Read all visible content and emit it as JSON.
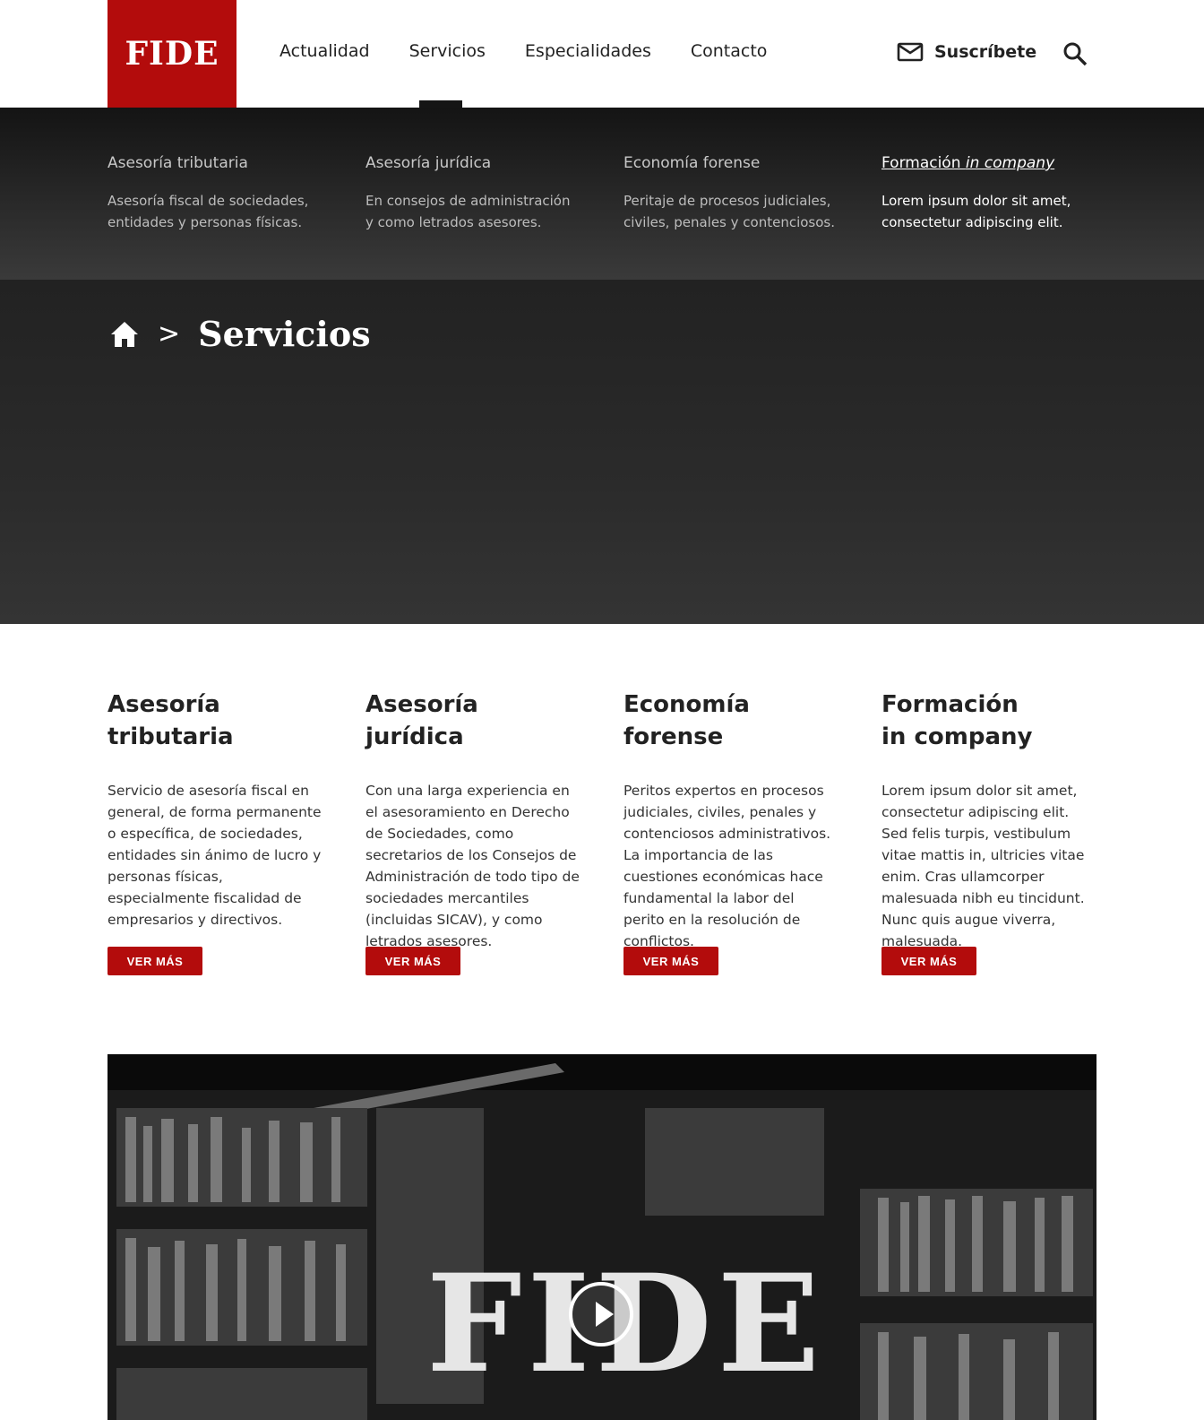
{
  "header": {
    "logo": "FIDE",
    "nav": [
      "Actualidad",
      "Servicios",
      "Especialidades",
      "Contacto"
    ],
    "subscribe_label": "Suscríbete"
  },
  "dropdown": {
    "items": [
      {
        "title": "Asesoría tributaria",
        "desc": "Asesoría fiscal de sociedades, entidades y personas físicas."
      },
      {
        "title": "Asesoría jurídica",
        "desc": "En consejos de administración y como letrados asesores."
      },
      {
        "title": "Economía forense",
        "desc": "Peritaje de procesos judiciales, civiles, penales y contenciosos."
      },
      {
        "title_prefix": "Formación ",
        "title_italic": "in company",
        "desc": "Lorem ipsum dolor sit amet, consectetur adipiscing elit."
      }
    ]
  },
  "breadcrumb": {
    "separator": ">",
    "current": "Servicios"
  },
  "services": [
    {
      "line1": "Asesoría",
      "line2": "tributaria",
      "text": "Servicio de asesoría fiscal en general, de forma permanente o específica, de sociedades, entidades sin ánimo de lucro y personas físicas, especialmente fiscalidad de empresarios y directivos.",
      "button": "VER MÁS"
    },
    {
      "line1": "Asesoría",
      "line2": "jurídica",
      "text": "Con una larga experiencia en el asesoramiento en Derecho de Sociedades, como secretarios de los Consejos de Administración de todo tipo de sociedades mercantiles (incluidas SICAV), y como letrados asesores.",
      "button": "VER MÁS"
    },
    {
      "line1": "Economía",
      "line2": "forense",
      "text": "Peritos expertos en procesos judiciales, civiles, penales y contenciosos administrativos. La importancia de las cuestiones económicas hace fundamental la labor del perito en la resolución de conflictos.",
      "button": "VER MÁS"
    },
    {
      "line1": "Formación",
      "line2": "in company",
      "text": "Lorem ipsum dolor sit amet, consectetur adipiscing elit. Sed felis turpis, vestibulum vitae mattis in, ultricies vitae enim. Cras ullamcorper malesuada nibh eu tincidunt. Nunc quis augue viverra, malesuada.",
      "button": "VER MÁS"
    }
  ],
  "video": {
    "logo": "FIDE"
  },
  "colors": {
    "brand_red": "#b30c0c",
    "dark": "#1a1a1a"
  },
  "icons": [
    "mail-icon",
    "search-icon",
    "home-icon",
    "play-icon"
  ]
}
